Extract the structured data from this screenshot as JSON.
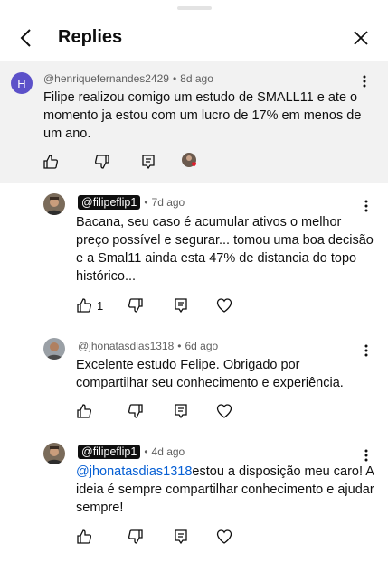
{
  "header": {
    "title": "Replies",
    "back_icon": "chevron-left-icon",
    "close_icon": "close-icon"
  },
  "top_comment": {
    "avatar_letter": "H",
    "avatar_color": "#5c51c9",
    "author": "@henriquefernandes2429",
    "time": "8d ago",
    "text": "Filipe realizou comigo um estudo de SMALL11 e ate o momento ja estou com um lucro de 17% em menos de um ano."
  },
  "replies": [
    {
      "author": "@filipeflip1",
      "is_creator": true,
      "time": "7d ago",
      "text": "Bacana, seu caso é acumular ativos o melhor preço possível e segurar... tomou uma boa decisão e a Smal11 ainda esta 47% de distancia do topo histórico...",
      "likes": "1"
    },
    {
      "author": "@jhonatasdias1318",
      "is_creator": false,
      "time": "6d ago",
      "text": "Excelente estudo Felipe. Obrigado por compartilhar seu conhecimento e experiência.",
      "likes": ""
    },
    {
      "author": "@filipeflip1",
      "is_creator": true,
      "time": "4d ago",
      "mention": "@jhonatasdias1318",
      "text": "estou a disposição meu caro! A ideia é sempre compartilhar conhecimento e ajudar sempre!",
      "likes": ""
    }
  ]
}
